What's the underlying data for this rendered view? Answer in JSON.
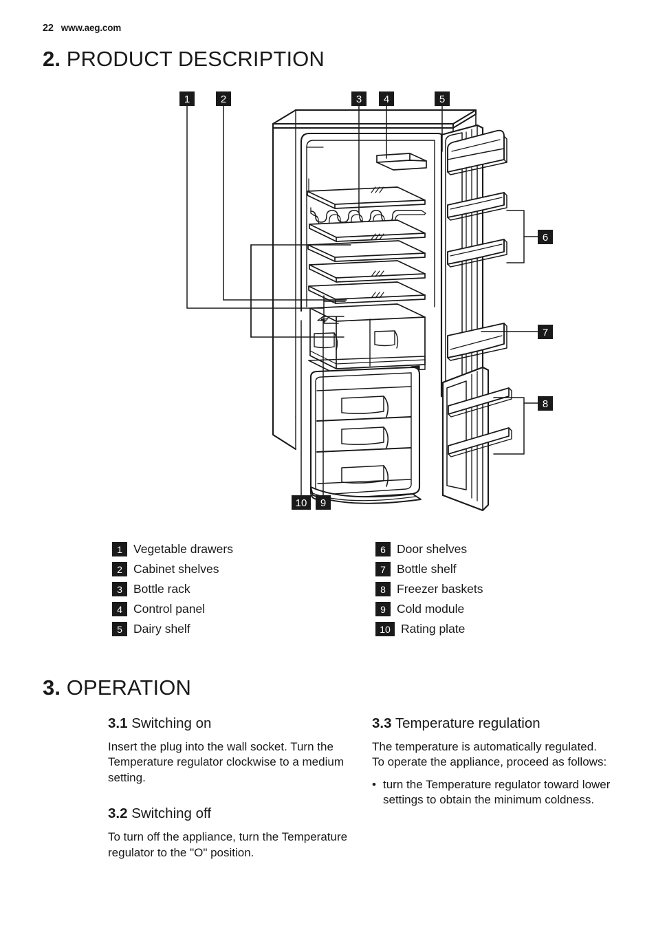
{
  "header": {
    "page_number": "22",
    "website": "www.aeg.com"
  },
  "chapters": [
    {
      "number": "2.",
      "title": "PRODUCT DESCRIPTION"
    },
    {
      "number": "3.",
      "title": "OPERATION"
    }
  ],
  "diagram": {
    "name": "fridge-freezer-cutaway",
    "callouts": [
      {
        "id": "1",
        "label": "Vegetable drawers"
      },
      {
        "id": "2",
        "label": "Cabinet shelves"
      },
      {
        "id": "3",
        "label": "Bottle rack"
      },
      {
        "id": "4",
        "label": "Control panel"
      },
      {
        "id": "5",
        "label": "Dairy shelf"
      },
      {
        "id": "6",
        "label": "Door shelves"
      },
      {
        "id": "7",
        "label": "Bottle shelf"
      },
      {
        "id": "8",
        "label": "Freezer baskets"
      },
      {
        "id": "9",
        "label": "Cold module"
      },
      {
        "id": "10",
        "label": "Rating plate"
      }
    ]
  },
  "legend": {
    "left": [
      {
        "id": "1",
        "label": "Vegetable drawers"
      },
      {
        "id": "2",
        "label": "Cabinet shelves"
      },
      {
        "id": "3",
        "label": "Bottle rack"
      },
      {
        "id": "4",
        "label": "Control panel"
      },
      {
        "id": "5",
        "label": "Dairy shelf"
      }
    ],
    "right": [
      {
        "id": "6",
        "label": "Door shelves"
      },
      {
        "id": "7",
        "label": "Bottle shelf"
      },
      {
        "id": "8",
        "label": "Freezer baskets"
      },
      {
        "id": "9",
        "label": "Cold module"
      },
      {
        "id": "10",
        "label": "Rating plate"
      }
    ]
  },
  "sections": {
    "s31": {
      "number": "3.1",
      "title": "Switching on",
      "body": "Insert the plug into the wall socket. Turn the Temperature regulator clockwise to a medium setting."
    },
    "s32": {
      "number": "3.2",
      "title": "Switching off",
      "body": "To turn off the appliance, turn the Temperature regulator to the \"O\" position."
    },
    "s33": {
      "number": "3.3",
      "title": "Temperature regulation",
      "body1": "The temperature is automatically regulated.",
      "body2": "To operate the appliance, proceed as follows:",
      "bullet_marker": "•",
      "bullets": [
        "turn the Temperature regulator toward lower settings to obtain the minimum coldness."
      ]
    }
  },
  "colors": {
    "ink": "#1a1a1a",
    "paper": "#ffffff",
    "badge_bg": "#1a1a1a",
    "badge_fg": "#ffffff"
  }
}
